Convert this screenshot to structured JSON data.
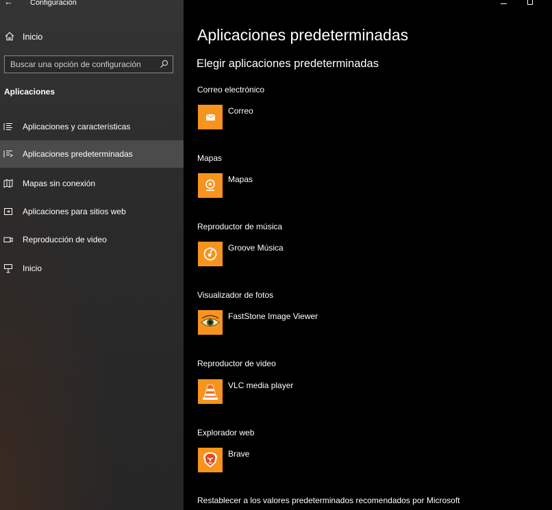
{
  "window": {
    "title": "Configuración"
  },
  "sidebar": {
    "home_label": "Inicio",
    "search_placeholder": "Buscar una opción de configuración",
    "section_heading": "Aplicaciones",
    "items": [
      {
        "label": "Aplicaciones y características",
        "icon": "list-icon"
      },
      {
        "label": "Aplicaciones predeterminadas",
        "icon": "default-apps-icon",
        "selected": true
      },
      {
        "label": "Mapas sin conexión",
        "icon": "offline-map-icon"
      },
      {
        "label": "Aplicaciones para sitios web",
        "icon": "website-apps-icon"
      },
      {
        "label": "Reproducción de video",
        "icon": "video-icon"
      },
      {
        "label": "Inicio",
        "icon": "startup-icon"
      }
    ]
  },
  "main": {
    "title": "Aplicaciones predeterminadas",
    "subtitle": "Elegir aplicaciones predeterminadas",
    "defaults": [
      {
        "category": "Correo electrónico",
        "app": "Correo",
        "icon": "mail-icon"
      },
      {
        "category": "Mapas",
        "app": "Mapas",
        "icon": "maps-icon"
      },
      {
        "category": "Reproductor de música",
        "app": "Groove Música",
        "icon": "groove-music-icon"
      },
      {
        "category": "Visualizador de fotos",
        "app": "FastStone Image Viewer",
        "icon": "faststone-eye-icon"
      },
      {
        "category": "Reproductor de video",
        "app": "VLC media player",
        "icon": "vlc-cone-icon"
      },
      {
        "category": "Explorador web",
        "app": "Brave",
        "icon": "brave-lion-icon"
      }
    ],
    "reset_text": "Restablecer a los valores predeterminados recomendados por Microsoft"
  },
  "colors": {
    "tile": "#f7941d",
    "selected_bg": "#4b4b4b",
    "sidebar_bg": "#2b2b2b",
    "main_bg": "#000000"
  }
}
